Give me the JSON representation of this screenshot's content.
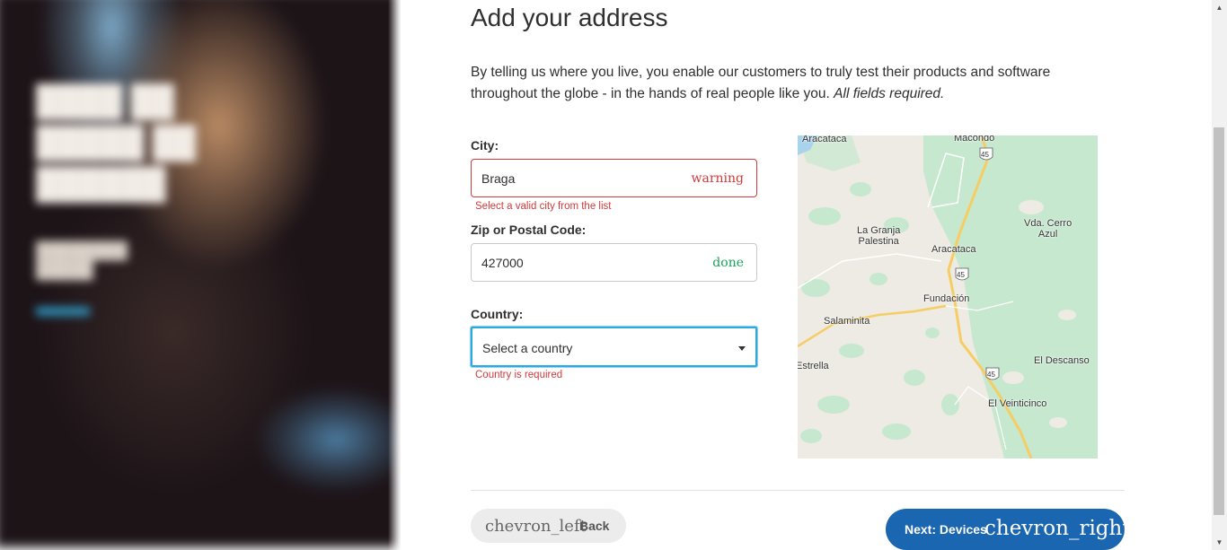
{
  "page": {
    "heading": "Add your address",
    "intro_main": "By telling us where you live, you enable our customers to truly test their products and software throughout the globe - in the hands of real people like you.",
    "intro_em": "All fields required."
  },
  "form": {
    "city": {
      "label": "City:",
      "value": "Braga",
      "status_icon": "warning",
      "error": "Select a valid city from the list"
    },
    "zip": {
      "label": "Zip or Postal Code:",
      "value": "427000",
      "status_icon": "done"
    },
    "country": {
      "label": "Country:",
      "selected": "Select a country",
      "error": "Country is required"
    }
  },
  "map": {
    "labels": [
      "Aracataca",
      "Macondo",
      "45",
      "La Granja\nPalestina",
      "Aracataca",
      "Vda. Cerro\nAzul",
      "45",
      "Fundación",
      "Salaminita",
      "Estrella",
      "45",
      "El Descanso",
      "El Veinticinco"
    ],
    "colors": {
      "land": "#eeebe4",
      "forest": "#c6e8cf",
      "road": "#f5cd63",
      "water": "#a9d3ec"
    }
  },
  "nav": {
    "back_icon": "chevron_left",
    "back_label": "Back",
    "next_label": "Next: Devices",
    "next_icon": "chevron_right"
  },
  "colors": {
    "primary": "#1a66b0",
    "error": "#d13a3a",
    "success": "#1aa35a",
    "focus": "#2ba9e1"
  }
}
